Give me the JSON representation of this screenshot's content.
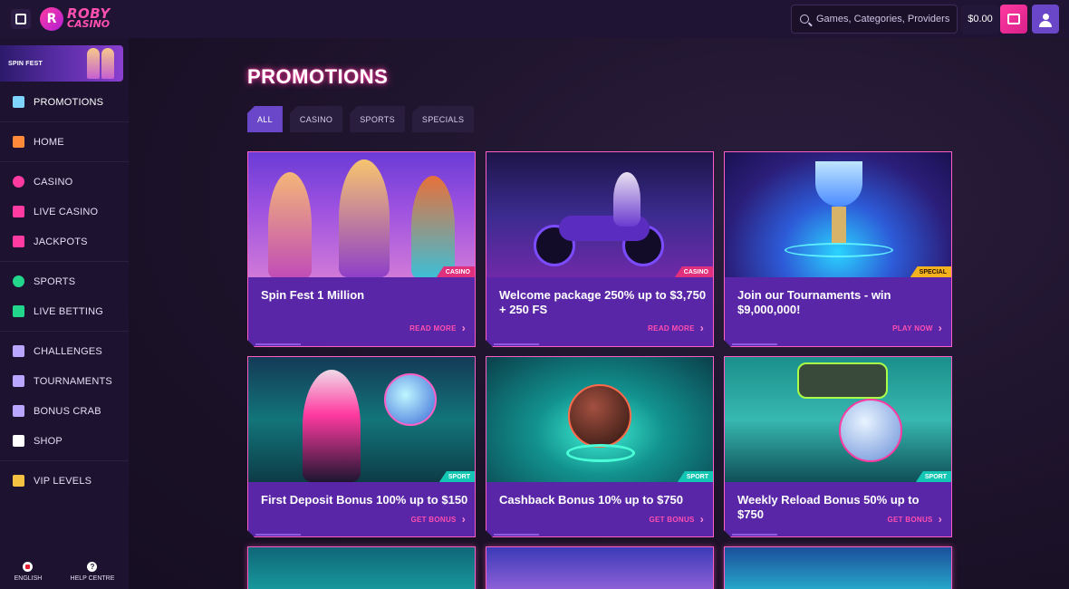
{
  "header": {
    "logo_line1": "ROBY",
    "logo_line2": "CASINO",
    "search_placeholder": "Games, Categories, Providers",
    "balance": "$0.00"
  },
  "sidebar": {
    "banner_label": "SPIN FEST",
    "items": [
      {
        "label": "PROMOTIONS",
        "icon": "gift-icon",
        "color": "#7fd3ff"
      },
      {
        "label": "HOME",
        "icon": "home-icon",
        "color": "#ff8a3a"
      },
      {
        "label": "CASINO",
        "icon": "casino-chip-icon",
        "color": "#ff3aa0"
      },
      {
        "label": "LIVE CASINO",
        "icon": "microphone-icon",
        "color": "#ff3aa0"
      },
      {
        "label": "JACKPOTS",
        "icon": "seven-icon",
        "color": "#ff3aa0"
      },
      {
        "label": "SPORTS",
        "icon": "soccer-ball-icon",
        "color": "#22d68c"
      },
      {
        "label": "LIVE BETTING",
        "icon": "ticket-icon",
        "color": "#22d68c"
      },
      {
        "label": "CHALLENGES",
        "icon": "medal-icon",
        "color": "#b9a7ff"
      },
      {
        "label": "TOURNAMENTS",
        "icon": "trophy-icon",
        "color": "#b9a7ff"
      },
      {
        "label": "BONUS CRAB",
        "icon": "claw-icon",
        "color": "#b9a7ff"
      },
      {
        "label": "SHOP",
        "icon": "cart-icon",
        "color": "#ffffff"
      },
      {
        "label": "VIP LEVELS",
        "icon": "crown-icon",
        "color": "#f5c242"
      }
    ],
    "footer": {
      "language": "ENGLISH",
      "help": "HELP CENTRE"
    }
  },
  "main": {
    "title": "PROMOTIONS",
    "filters": [
      "ALL",
      "CASINO",
      "SPORTS",
      "SPECIALS"
    ],
    "cards": [
      {
        "title": "Spin Fest 1 Million",
        "tag": "CASINO",
        "cta": "READ MORE"
      },
      {
        "title": "Welcome package 250% up to $3,750 + 250 FS",
        "tag": "CASINO",
        "cta": "READ MORE"
      },
      {
        "title": "Join our Tournaments - win $9,000,000!",
        "tag": "SPECIAL",
        "cta": "PLAY NOW"
      },
      {
        "title": "First Deposit Bonus 100% up to $150",
        "tag": "SPORT",
        "cta": "GET BONUS"
      },
      {
        "title": "Cashback Bonus 10% up to $750",
        "tag": "SPORT",
        "cta": "GET BONUS"
      },
      {
        "title": "Weekly Reload Bonus 50% up to $750",
        "tag": "SPORT",
        "cta": "GET BONUS"
      }
    ]
  }
}
